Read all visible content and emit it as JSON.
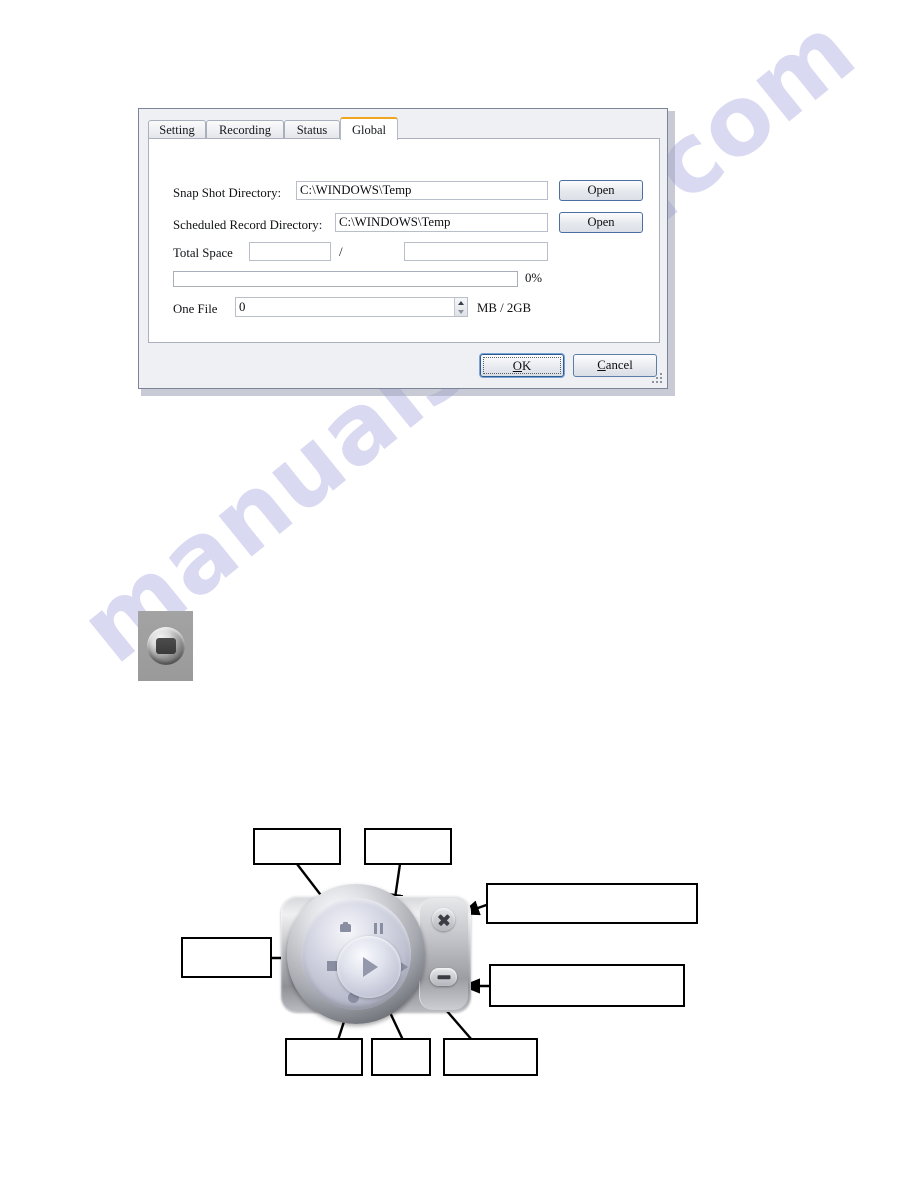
{
  "page": {
    "watermark": "manualshive.com",
    "background_color": "#ffffff"
  },
  "dialog": {
    "accent_color": "#f0a51e",
    "tabs": [
      {
        "label": "Setting",
        "active": false
      },
      {
        "label": "Recording",
        "active": false
      },
      {
        "label": "Status",
        "active": false
      },
      {
        "label": "Global",
        "active": true
      }
    ],
    "fields": {
      "snap_shot_label": "Snap Shot Directory:",
      "snap_shot_value": "C:\\WINDOWS\\Temp",
      "snap_shot_open": "Open",
      "scheduled_label": "Scheduled Record Directory:",
      "scheduled_value": "C:\\WINDOWS\\Temp",
      "scheduled_open": "Open",
      "total_space_label": "Total Space",
      "total_space_used": "",
      "total_space_separator": "/",
      "total_space_total": "",
      "progress_percent_label": "0%",
      "progress_percent_value": 0,
      "one_file_label": "One File",
      "one_file_value": "0",
      "one_file_unit": "MB / 2GB"
    },
    "footer": {
      "ok_label": "OK",
      "ok_accel": "O",
      "cancel_label": "Cancel",
      "cancel_accel": "C"
    }
  },
  "media_widget": {
    "buttons": [
      {
        "name": "snapshot",
        "glyph": "camera-icon"
      },
      {
        "name": "pause",
        "glyph": "pause-icon"
      },
      {
        "name": "play",
        "glyph": "play-icon"
      },
      {
        "name": "stop",
        "glyph": "stop-icon"
      },
      {
        "name": "next",
        "glyph": "next-icon"
      },
      {
        "name": "record",
        "glyph": "record-icon"
      },
      {
        "name": "close",
        "glyph": "close-icon"
      },
      {
        "name": "minimize",
        "glyph": "minimize-icon"
      }
    ]
  },
  "callouts": [
    {
      "id": "callout-snapshot",
      "text": ""
    },
    {
      "id": "callout-pause",
      "text": ""
    },
    {
      "id": "callout-close",
      "text": ""
    },
    {
      "id": "callout-stop",
      "text": ""
    },
    {
      "id": "callout-minimize",
      "text": ""
    },
    {
      "id": "callout-record",
      "text": ""
    },
    {
      "id": "callout-play",
      "text": ""
    },
    {
      "id": "callout-next",
      "text": ""
    }
  ]
}
